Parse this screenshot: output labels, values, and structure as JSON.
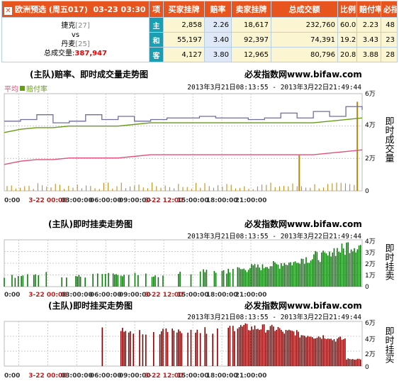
{
  "match": {
    "title": "欧洲预选 (周五017)",
    "time": "03-23 03:30",
    "home": "捷克",
    "home_rank": "[27]",
    "vs": "vs",
    "away": "丹麦",
    "away_rank": "[25]",
    "total_label": "总成交量:",
    "total_value": "387,947"
  },
  "columns": [
    "项",
    "买家挂牌",
    "赔率",
    "卖家挂牌",
    "总成交额",
    "比例",
    "赔付率",
    "必指"
  ],
  "rows": [
    {
      "type": "主",
      "buy": "2,858",
      "odds": "2.26",
      "sell": "18,617",
      "total": "232,760",
      "ratio": "60.0",
      "pay": "2.23",
      "must": "48"
    },
    {
      "type": "和",
      "buy": "55,197",
      "odds": "3.40",
      "sell": "92,397",
      "total": "74,391",
      "ratio": "19.2",
      "pay": "3.43",
      "must": "23"
    },
    {
      "type": "客",
      "buy": "4,127",
      "odds": "3.80",
      "sell": "12,965",
      "total": "80,796",
      "ratio": "20.8",
      "pay": "3.88",
      "must": "28"
    }
  ],
  "colors": {
    "header_bg": "#e8541e",
    "type_bg": "#1a9fb2",
    "green": "#0a7d0a",
    "red": "#8b0000",
    "gold": "#b8860b",
    "pink": "#e0507a",
    "olive": "#6a9a1a",
    "slate": "#6f6f9a"
  },
  "charts": {
    "site": "必发指数网www.bifaw.com",
    "range": "2013年3月21日08:13:55 - 2013年3月22日21:49:44",
    "x_ticks": [
      "0:00",
      "3-22 00:00",
      "03:00:00",
      "06:00:00",
      "09:00:00",
      "3-22 12:00",
      "15:00:00",
      "18:00:00",
      "21:00:00"
    ],
    "chart1": {
      "title": "(主队)赔率、即时成交量走势图",
      "legend_avg": "平均",
      "legend_pay": "赔付率",
      "vertical_label": "即时成交量",
      "y_ticks": [
        "6万",
        "4万",
        "2万",
        "0"
      ]
    },
    "chart2": {
      "title": "(主队)即时挂卖走势图",
      "vertical_label": "即时挂卖",
      "y_ticks": [
        "4万",
        "3万",
        "2万",
        "1万",
        "0"
      ]
    },
    "chart3": {
      "title": "(主队)即时挂买走势图",
      "vertical_label": "即时挂买",
      "y_ticks": [
        "6万",
        "4万",
        "2万",
        "0"
      ]
    }
  },
  "chart_data": [
    {
      "type": "line",
      "title": "(主队)赔率、即时成交量走势图",
      "ylabel": "即时成交量",
      "ylim": [
        0,
        60000
      ],
      "series": [
        {
          "name": "平均",
          "values": [
            43000,
            44000,
            47000,
            42000,
            43000,
            47000,
            44000,
            46000,
            43000,
            44000,
            45000,
            45000,
            46000,
            45000,
            45000,
            44000,
            45000,
            48000,
            45000,
            49000,
            46000,
            52000,
            50000
          ]
        },
        {
          "name": "赔付率",
          "values": [
            36000,
            38000,
            39000,
            39000,
            40000,
            40000,
            40000,
            40000,
            41000,
            42000,
            42000,
            42000,
            42000,
            42000,
            42000,
            42000,
            42000,
            42000,
            42000,
            42000,
            43000,
            44000,
            45000
          ]
        }
      ],
      "volume_spikes": [
        {
          "x": "3-22 14:30",
          "value": 22000
        },
        {
          "x": "3-22 20:30",
          "value": 55000
        }
      ]
    },
    {
      "type": "bar",
      "title": "(主队)即时挂卖走势图",
      "ylabel": "即时挂卖",
      "ylim": [
        0,
        40000
      ],
      "levels_by_hour": [
        10000,
        10000,
        12000,
        10000,
        10000,
        12000,
        11000,
        10000,
        12000,
        10000,
        12000,
        10000,
        14000,
        14000,
        16000,
        18000,
        20000,
        22000,
        26000,
        28000,
        34000,
        38000,
        37000
      ]
    },
    {
      "type": "bar",
      "title": "(主队)即时挂买走势图",
      "ylabel": "即时挂买",
      "ylim": [
        0,
        60000
      ],
      "levels_by_hour": [
        0,
        0,
        0,
        0,
        0,
        0,
        50000,
        50000,
        49000,
        50000,
        51000,
        50000,
        51000,
        52000,
        55000,
        54000,
        53000,
        48000,
        44000,
        42000,
        38000,
        10000,
        3000
      ]
    }
  ]
}
